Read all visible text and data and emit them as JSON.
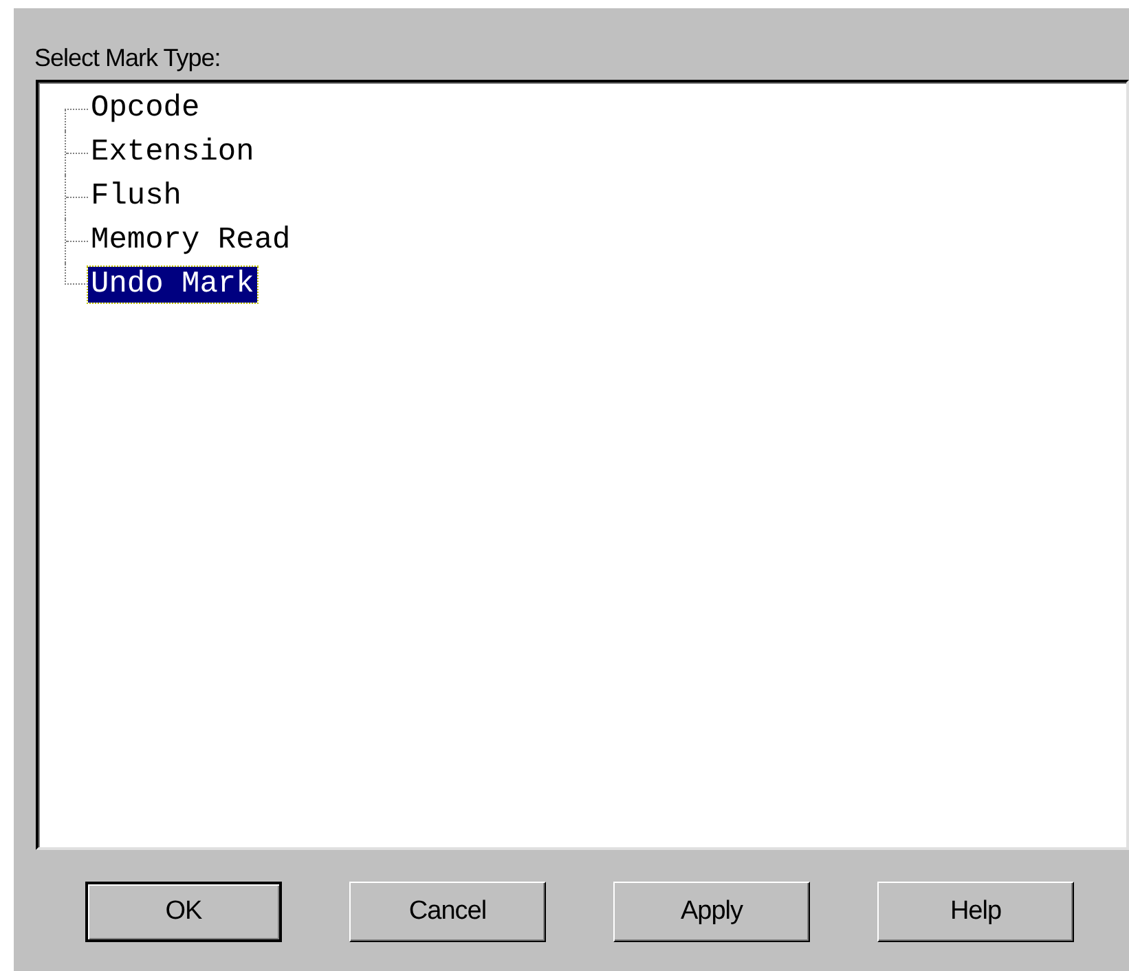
{
  "label": "Select Mark Type:",
  "tree": {
    "items": [
      {
        "label": "Opcode",
        "selected": false
      },
      {
        "label": "Extension",
        "selected": false
      },
      {
        "label": "Flush",
        "selected": false
      },
      {
        "label": "Memory Read",
        "selected": false
      },
      {
        "label": "Undo Mark",
        "selected": true
      }
    ]
  },
  "buttons": [
    {
      "label": "OK",
      "default": true
    },
    {
      "label": "Cancel",
      "default": false
    },
    {
      "label": "Apply",
      "default": false
    },
    {
      "label": "Help",
      "default": false
    }
  ]
}
